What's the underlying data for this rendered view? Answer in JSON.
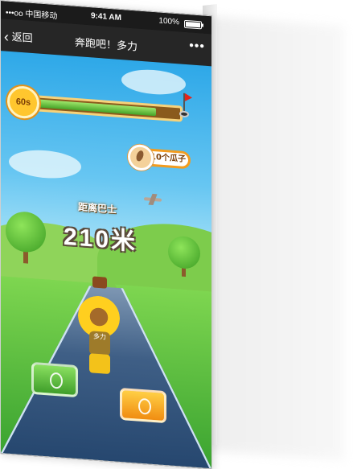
{
  "status_bar": {
    "carrier": "•••oo 中国移动",
    "time": "9:41 AM",
    "battery": "100%"
  },
  "nav_bar": {
    "back_label": "返回",
    "title": "奔跑吧！多力",
    "more_label": "•••"
  },
  "game": {
    "timer": "60s",
    "progress": 0.82,
    "seed_count": "10个瓜子",
    "distance_label": "距离巴士",
    "distance_value": "210米",
    "shirt_text": "多力"
  },
  "colors": {
    "sky_top": "#2ea8e8",
    "progress_fill": "#46a428",
    "left_button": "#3f9e2a",
    "right_button": "#f08c11",
    "timer_badge": "#ffc62e"
  }
}
